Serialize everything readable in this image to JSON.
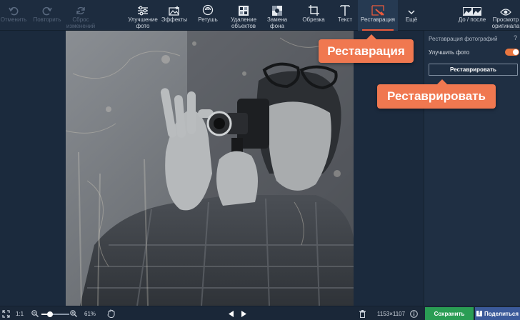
{
  "toolbar": {
    "undo": "Отменить",
    "redo": "Повторить",
    "reset": "Сброс\nизменений",
    "enhance": "Улучшение\nфото",
    "effects": "Эффекты",
    "retouch": "Ретушь",
    "remove_objects": "Удаление\nобъектов",
    "replace_bg": "Замена\nфона",
    "crop": "Обрезка",
    "text": "Текст",
    "restoration": "Реставрация",
    "more": "Ещё",
    "before_after": "До / после",
    "preview": "Просмотр\nоригинала"
  },
  "panel": {
    "title": "Реставрация фотографий",
    "help": "?",
    "enhance_label": "Улучшить фото",
    "enhance_on": true,
    "restore_button": "Реставрировать"
  },
  "callouts": {
    "restoration_tab": "Реставрация",
    "restore_button": "Реставрировать"
  },
  "bottombar": {
    "ratio": "1:1",
    "zoom_percent": "61%",
    "zoom_slider_fraction": 0.3,
    "image_size": "1153×1107",
    "save": "Сохранить",
    "share": "Поделиться",
    "share_logo": "f"
  },
  "colors": {
    "accent": "#e95a3c",
    "callout": "#f07850",
    "save_green": "#2a9d54",
    "facebook_blue": "#3b5a9a",
    "toggle_on": "#e9763f"
  }
}
